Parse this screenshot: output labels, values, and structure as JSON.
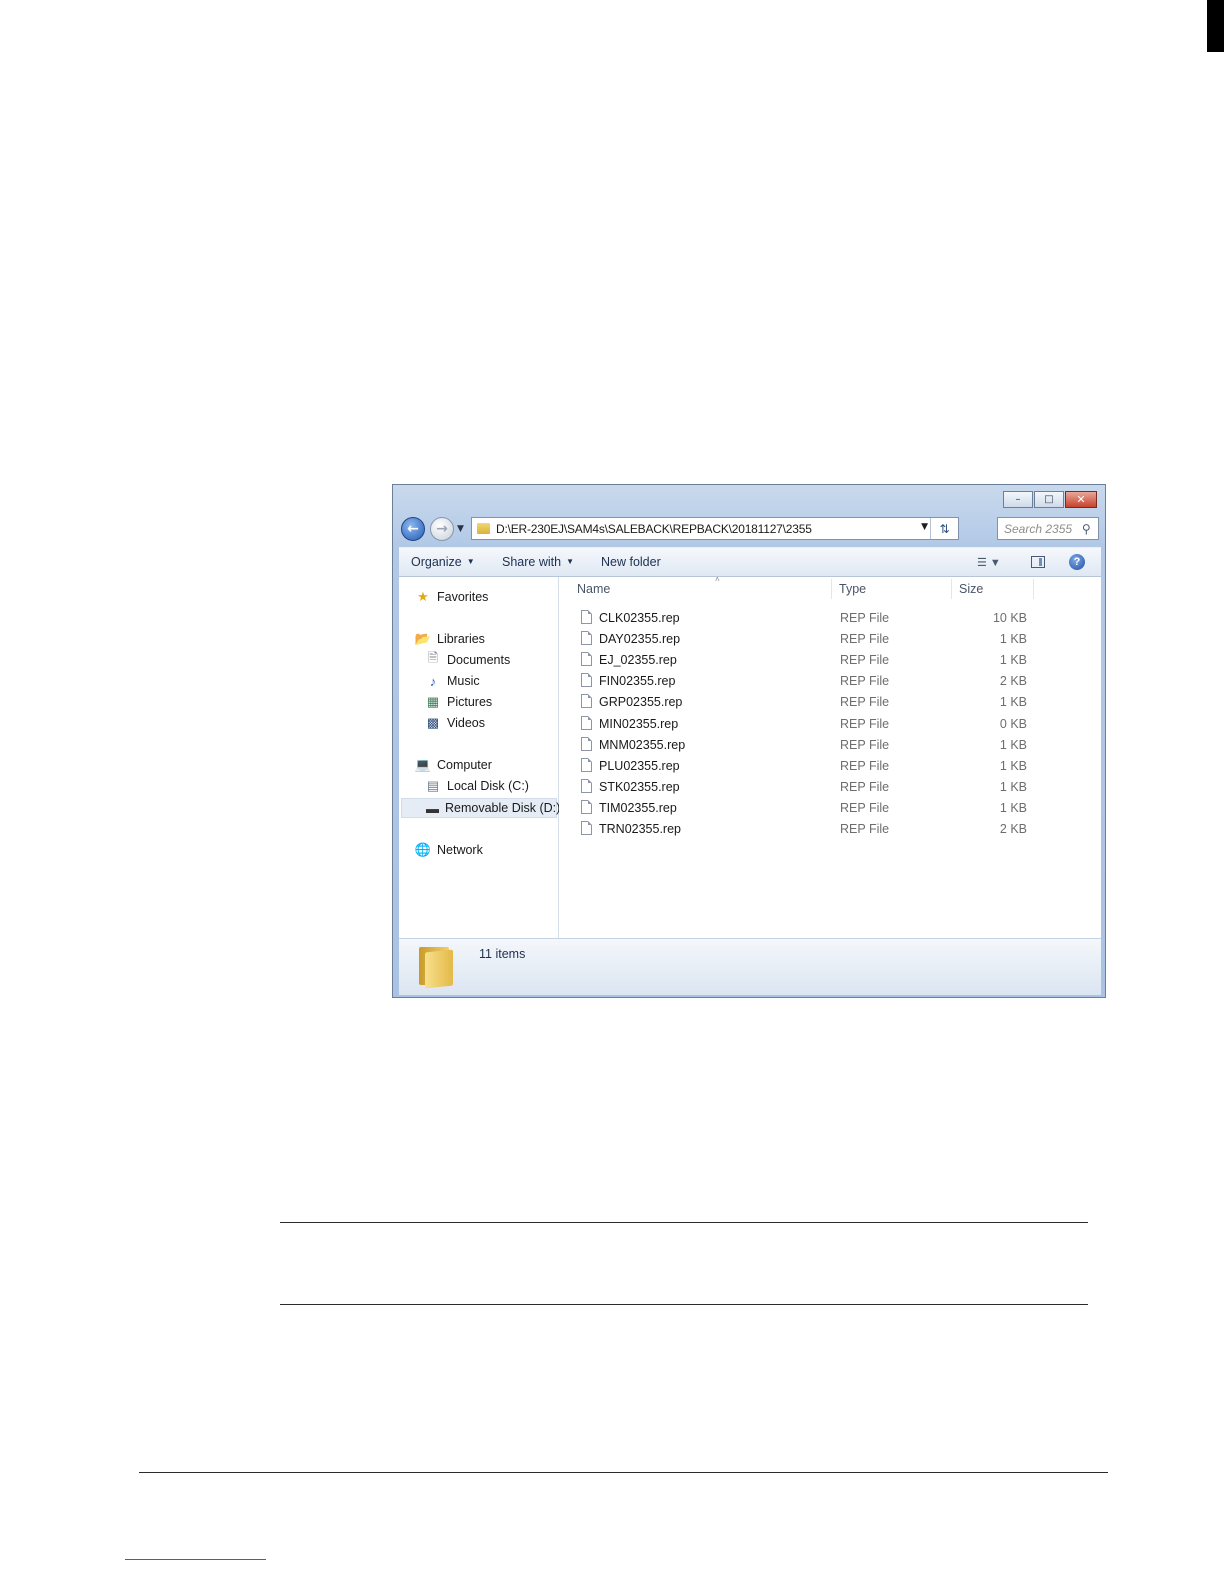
{
  "window": {
    "address_path": "D:\\ER-230EJ\\SAM4s\\SALEBACK\\REPBACK\\20181127\\2355",
    "search_placeholder": "Search 2355"
  },
  "toolbar": {
    "organize_label": "Organize",
    "share_label": "Share with",
    "new_folder_label": "New folder"
  },
  "nav": {
    "favorites": "Favorites",
    "libraries": "Libraries",
    "documents": "Documents",
    "music": "Music",
    "pictures": "Pictures",
    "videos": "Videos",
    "computer": "Computer",
    "local_disk": "Local Disk (C:)",
    "removable_disk": "Removable Disk (D:)",
    "network": "Network"
  },
  "columns": {
    "name": "Name",
    "type": "Type",
    "size": "Size"
  },
  "files": [
    {
      "name": "CLK02355.rep",
      "type": "REP File",
      "size": "10 KB"
    },
    {
      "name": "DAY02355.rep",
      "type": "REP File",
      "size": "1 KB"
    },
    {
      "name": "EJ_02355.rep",
      "type": "REP File",
      "size": "1 KB"
    },
    {
      "name": "FIN02355.rep",
      "type": "REP File",
      "size": "2 KB"
    },
    {
      "name": "GRP02355.rep",
      "type": "REP File",
      "size": "1 KB"
    },
    {
      "name": "MIN02355.rep",
      "type": "REP File",
      "size": "0 KB"
    },
    {
      "name": "MNM02355.rep",
      "type": "REP File",
      "size": "1 KB"
    },
    {
      "name": "PLU02355.rep",
      "type": "REP File",
      "size": "1 KB"
    },
    {
      "name": "STK02355.rep",
      "type": "REP File",
      "size": "1 KB"
    },
    {
      "name": "TIM02355.rep",
      "type": "REP File",
      "size": "1 KB"
    },
    {
      "name": "TRN02355.rep",
      "type": "REP File",
      "size": "2 KB"
    }
  ],
  "status": {
    "item_count": "11 items"
  },
  "icons": {
    "back": "back-arrow-icon",
    "forward": "forward-arrow-icon",
    "refresh": "refresh-icon",
    "search": "search-icon",
    "help": "help-icon",
    "file": "file-icon",
    "folder": "folder-icon"
  }
}
